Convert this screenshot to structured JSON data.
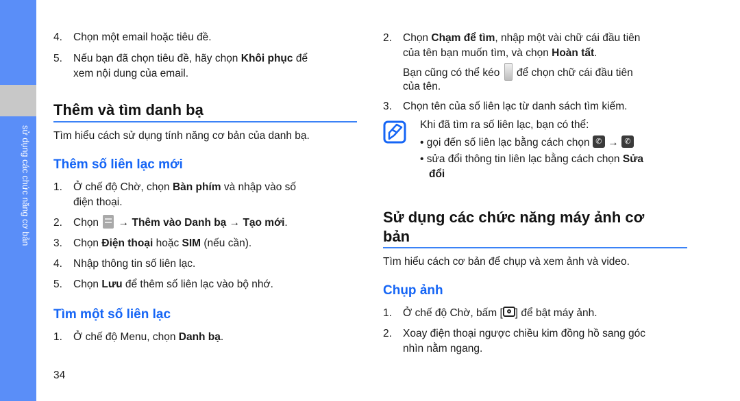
{
  "sidebar": {
    "label": "sử dụng các chức năng cơ bản",
    "color": "#5a8ef8"
  },
  "left": {
    "prev_steps": [
      {
        "num": "4.",
        "parts": [
          {
            "t": "Chọn một email hoặc tiêu đề."
          }
        ]
      },
      {
        "num": "5.",
        "line1": [
          {
            "t": "Nếu bạn đã chọn tiêu đề, hãy chọn "
          },
          {
            "t": "Khôi phục",
            "b": true
          },
          {
            "t": " để"
          }
        ],
        "line2": "xem nội dung của email."
      }
    ],
    "section_title": "Thêm và tìm danh bạ",
    "section_intro": "Tìm hiểu cách sử dụng tính năng cơ bản của danh bạ.",
    "sub1": {
      "title": "Thêm số liên lạc mới",
      "steps": [
        {
          "num": "1.",
          "line1a": "Ở chế độ Chờ, chọn ",
          "line1b": "Bàn phím",
          "line1c": " và nhập vào số",
          "line2": "điện thoại."
        },
        {
          "num": "2.",
          "a": "Chọn ",
          "icon": "menu-icon",
          "b": " → ",
          "c": "Thêm vào Danh bạ",
          "d": " → ",
          "e": "Tạo mới",
          "f": "."
        },
        {
          "num": "3.",
          "a": "Chọn ",
          "b": "Điện thoại",
          "c": " hoặc ",
          "d": "SIM",
          "e": " (nếu cần)."
        },
        {
          "num": "4.",
          "a": "Nhập thông tin số liên lạc."
        },
        {
          "num": "5.",
          "a": "Chọn ",
          "b": "Lưu",
          "c": " để thêm số liên lạc vào bộ nhớ."
        }
      ]
    },
    "sub2": {
      "title": "Tìm một số liên lạc",
      "steps": [
        {
          "num": "1.",
          "a": "Ở chế độ Menu, chọn ",
          "b": "Danh bạ",
          "c": "."
        }
      ]
    },
    "page_number": "34"
  },
  "right": {
    "steps": [
      {
        "num": "2.",
        "l1a": "Chọn ",
        "l1b": "Chạm để tìm",
        "l1c": ", nhập một vài chữ cái đầu tiên",
        "l2a": "của tên bạn muốn tìm, và chọn ",
        "l2b": "Hoàn tất",
        "l2c": ".",
        "l3a": "Bạn cũng có thể kéo ",
        "l3icon": "scroll-bar-icon",
        "l3b": " để chọn chữ cái đầu tiên",
        "l4": "của tên."
      },
      {
        "num": "3.",
        "a": "Chọn tên của số liên lạc từ danh sách tìm kiếm."
      }
    ],
    "note": {
      "icon": "note-pencil-icon",
      "intro": "Khi đã tìm ra số liên lạc, bạn có thể:",
      "bullets": [
        {
          "a": "gọi đến số liên lạc bằng cách chọn ",
          "icon1": "contact-call-icon",
          "arrow": " → ",
          "icon2": "phone-icon"
        },
        {
          "a": "sửa đổi thông tin liên lạc bằng cách chọn ",
          "b": "Sửa",
          "line2": "đổi"
        }
      ]
    },
    "section_title_line1": "Sử dụng các chức năng máy ảnh cơ",
    "section_title_line2": "bản",
    "section_intro": "Tìm hiểu cách cơ bản để chụp và xem ảnh và video.",
    "sub": {
      "title": "Chụp ảnh",
      "steps": [
        {
          "num": "1.",
          "a": "Ở chế độ Chờ, bấm [",
          "icon": "camera-icon",
          "b": "] để bật máy ảnh."
        },
        {
          "num": "2.",
          "a": "Xoay điện thoại ngược chiều kim đồng hồ sang góc",
          "line2": "nhìn nằm ngang."
        }
      ]
    }
  },
  "colors": {
    "accent": "#1565f5",
    "rule": "#3b82f6",
    "sidebar": "#5a8ef8",
    "sidebar_tab": "#c8c8c8"
  }
}
